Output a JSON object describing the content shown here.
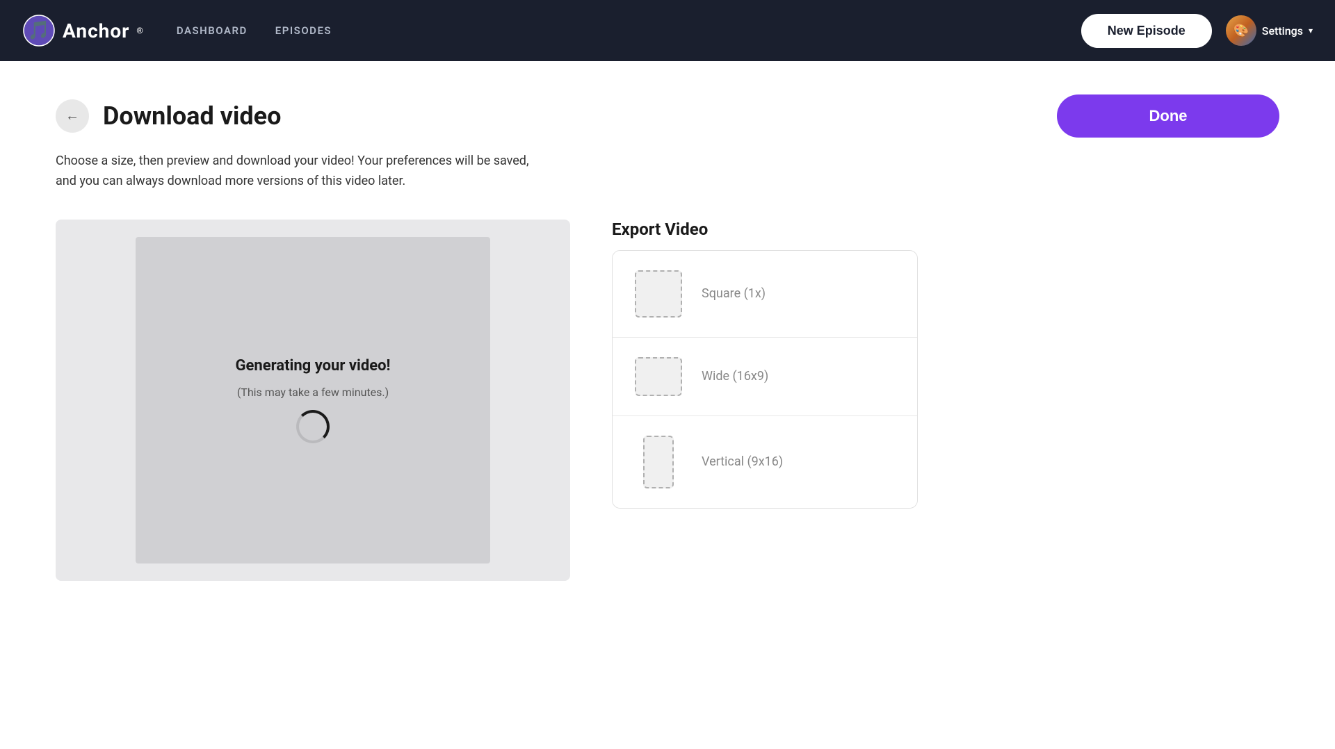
{
  "header": {
    "logo_text": "Anchor",
    "logo_registered": "®",
    "nav_items": [
      {
        "id": "dashboard",
        "label": "DASHBOARD"
      },
      {
        "id": "episodes",
        "label": "EPISODES"
      }
    ],
    "new_episode_label": "New Episode",
    "settings_label": "Settings",
    "settings_chevron": "▾"
  },
  "page": {
    "title": "Download video",
    "description": "Choose a size, then preview and download your video! Your preferences will be saved, and you can always download more versions of this video later.",
    "done_label": "Done",
    "back_icon": "←"
  },
  "video_preview": {
    "generating_text": "Generating your video!",
    "generating_sub": "(This may take a few minutes.)"
  },
  "export": {
    "title": "Export Video",
    "options": [
      {
        "id": "square",
        "label": "Square (1x)",
        "shape": "square"
      },
      {
        "id": "wide",
        "label": "Wide (16x9)",
        "shape": "wide"
      },
      {
        "id": "vertical",
        "label": "Vertical (9x16)",
        "shape": "vertical"
      }
    ]
  },
  "colors": {
    "accent_purple": "#7c3aed",
    "header_bg": "#1a1f2e",
    "nav_inactive": "#b0b8c8"
  }
}
